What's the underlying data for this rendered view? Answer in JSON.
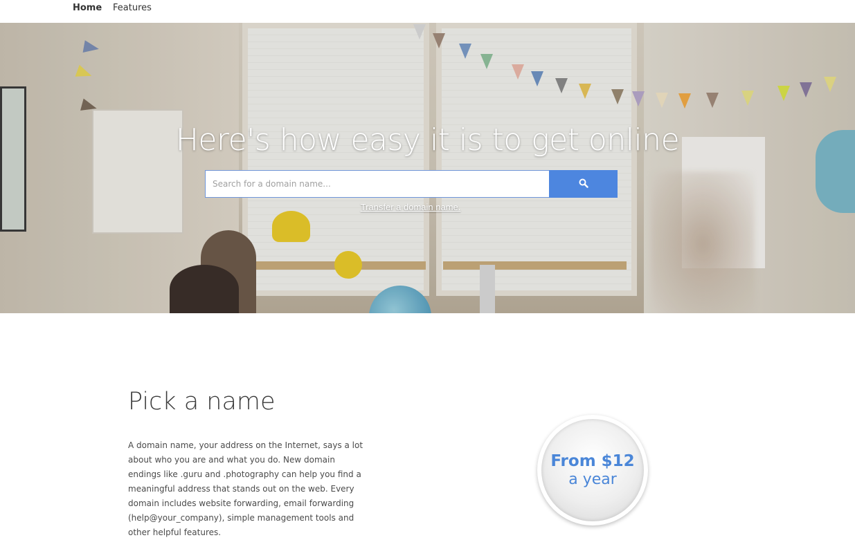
{
  "nav": {
    "items": [
      {
        "label": "Home",
        "active": true
      },
      {
        "label": "Features",
        "active": false
      }
    ]
  },
  "hero": {
    "title": "Here's how easy it is to get online",
    "search": {
      "placeholder": "Search for a domain name...",
      "button_icon": "search-icon",
      "button_color": "#4d86df"
    },
    "transfer_label": "Transfer a domain name."
  },
  "section": {
    "title": "Pick a name",
    "body": "A domain name, your address on the Internet, says a lot about who you are and what you do. New domain endings like .guru and .photography can help you find a meaningful address that stands out on the web. Every domain includes website forwarding, email forwarding (help@your_company), simple management tools and other helpful features."
  },
  "price_badge": {
    "main": "From $12",
    "sub": "a year",
    "color": "#4a86d8"
  }
}
